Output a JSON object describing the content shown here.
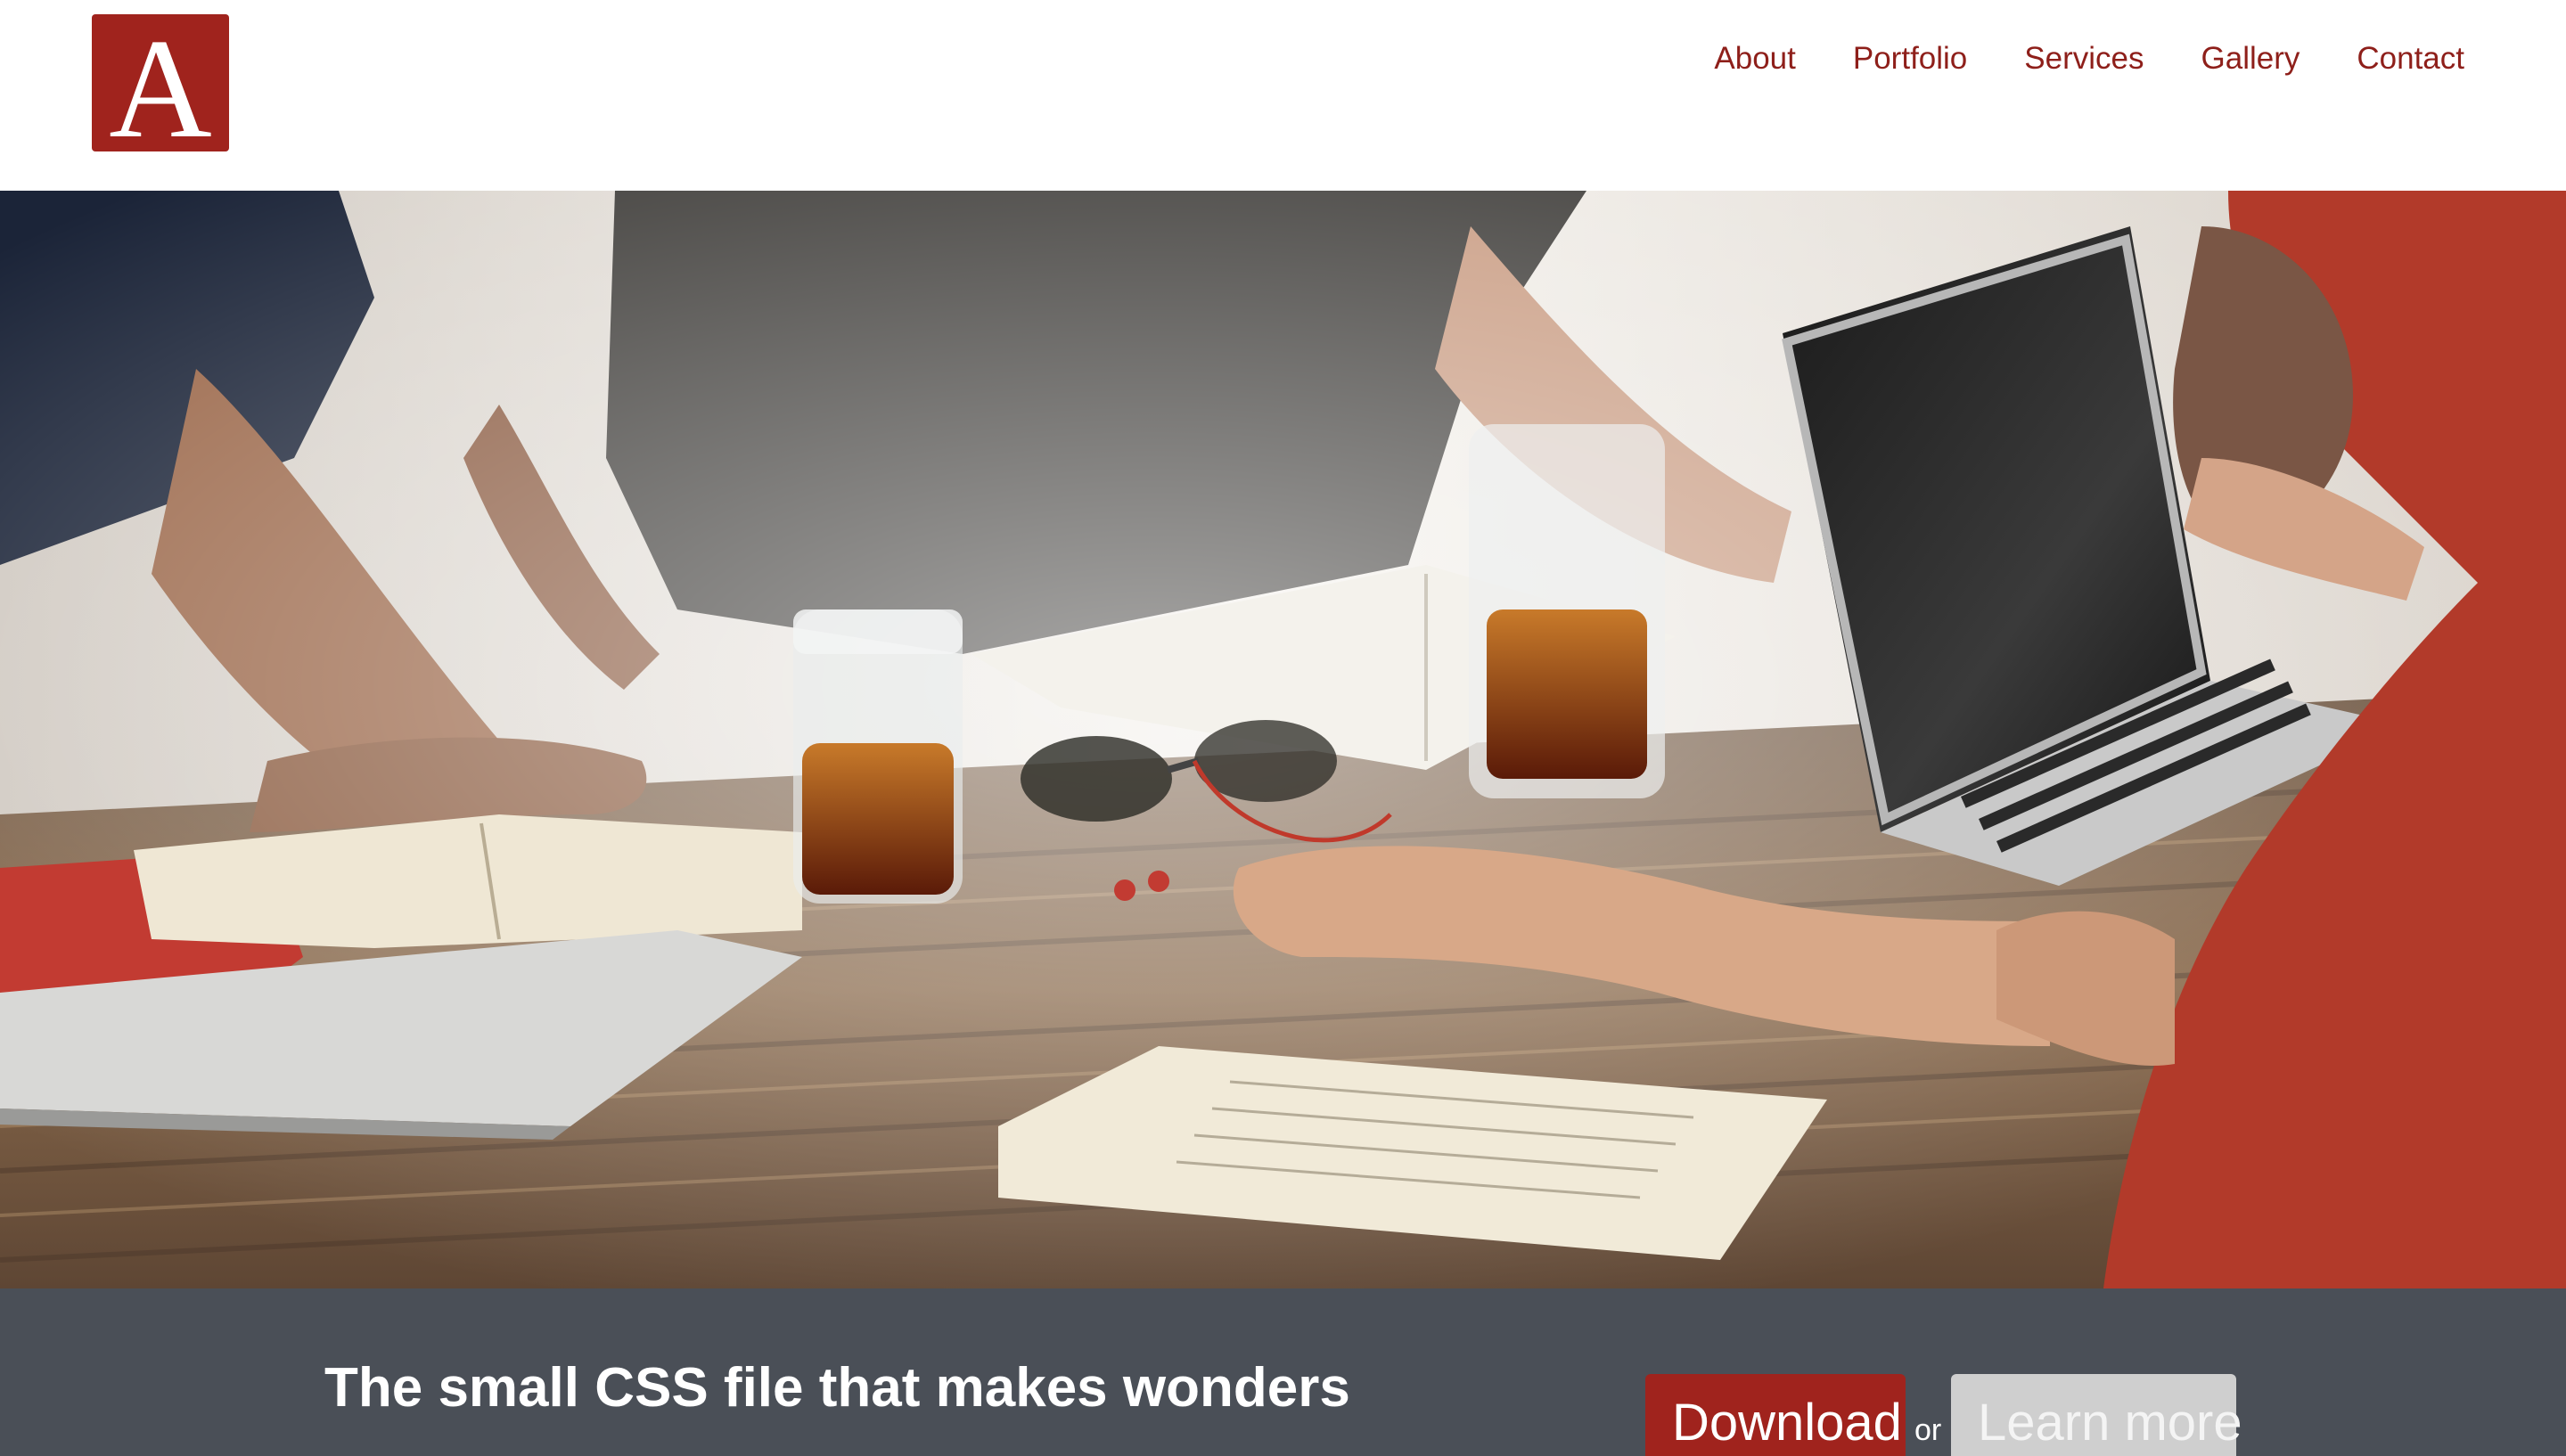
{
  "header": {
    "logo_letter": "A",
    "nav": [
      {
        "label": "About"
      },
      {
        "label": "Portfolio"
      },
      {
        "label": "Services"
      },
      {
        "label": "Gallery"
      },
      {
        "label": "Contact"
      }
    ]
  },
  "hero": {
    "image_subject": "team-meeting-photo"
  },
  "cta": {
    "title": "The small CSS file that makes wonders",
    "download_label": "Download",
    "or_label": "or",
    "learn_more_label": "Learn more"
  },
  "colors": {
    "brand": "#a0231d",
    "nav_text": "#8e1f1a",
    "cta_background": "#4a4f57",
    "secondary_button": "#cfcfcf"
  }
}
